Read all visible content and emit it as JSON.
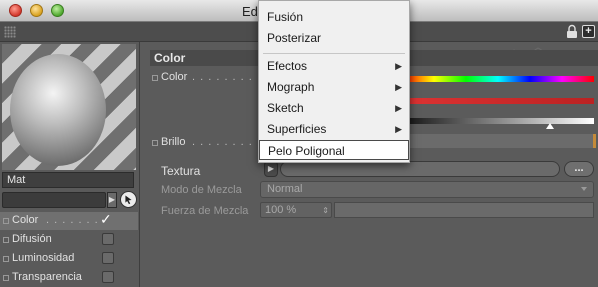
{
  "window": {
    "title": "Ed"
  },
  "left_panel": {
    "material_name": "Mat",
    "channels": [
      {
        "label": "Color",
        "checked": true,
        "selected": true
      },
      {
        "label": "Difusión",
        "checked": false
      },
      {
        "label": "Luminosidad",
        "checked": false
      },
      {
        "label": "Transparencia",
        "checked": false
      }
    ]
  },
  "right_panel": {
    "section_title": "Color",
    "color_label": "Color",
    "brillo_label": "Brillo",
    "textura_label": "Textura",
    "textura_button": "...",
    "modo_label": "Modo de Mezcla",
    "modo_value": "Normal",
    "fuerza_label": "Fuerza de Mezcla",
    "fuerza_value": "100 %"
  },
  "popup_menu": {
    "items": [
      {
        "label": "Fusión",
        "submenu": false
      },
      {
        "label": "Posterizar",
        "submenu": false
      },
      {
        "label": "Efectos",
        "submenu": true
      },
      {
        "label": "Mograph",
        "submenu": true
      },
      {
        "label": "Sketch",
        "submenu": true
      },
      {
        "label": "Superficies",
        "submenu": true
      },
      {
        "label": "Pelo Poligonal",
        "submenu": false,
        "highlighted": true
      }
    ],
    "submenu_glyph": "▶"
  },
  "colors": {
    "panel": "#5b5b5b",
    "menu_bg": "#f0f0f0",
    "accent_orange": "#c48a3a"
  }
}
